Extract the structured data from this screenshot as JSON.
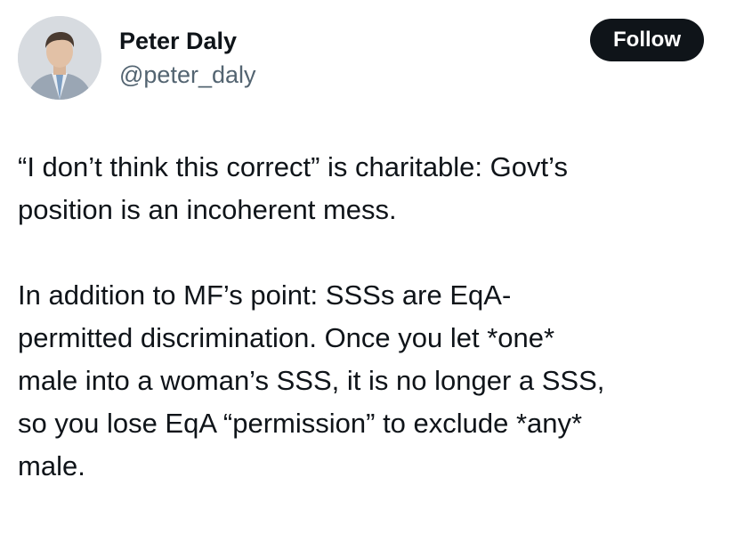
{
  "author": {
    "display_name": "Peter Daly",
    "handle": "@peter_daly",
    "avatar_icon": "profile-photo"
  },
  "follow_button": {
    "label": "Follow",
    "background": "#0f1419",
    "text_color": "#ffffff"
  },
  "tweet": {
    "paragraphs": [
      {
        "lines": [
          "“I don’t think this correct” is charitable: Govt’s",
          "position is an incoherent mess."
        ]
      },
      {
        "lines": [
          "In addition to MF’s point: SSSs are EqA-",
          "permitted discrimination. Once you let *one*",
          "male into a woman’s SSS, it is no longer a SSS,",
          "so you lose EqA “permission” to exclude *any*",
          "male."
        ]
      }
    ]
  }
}
